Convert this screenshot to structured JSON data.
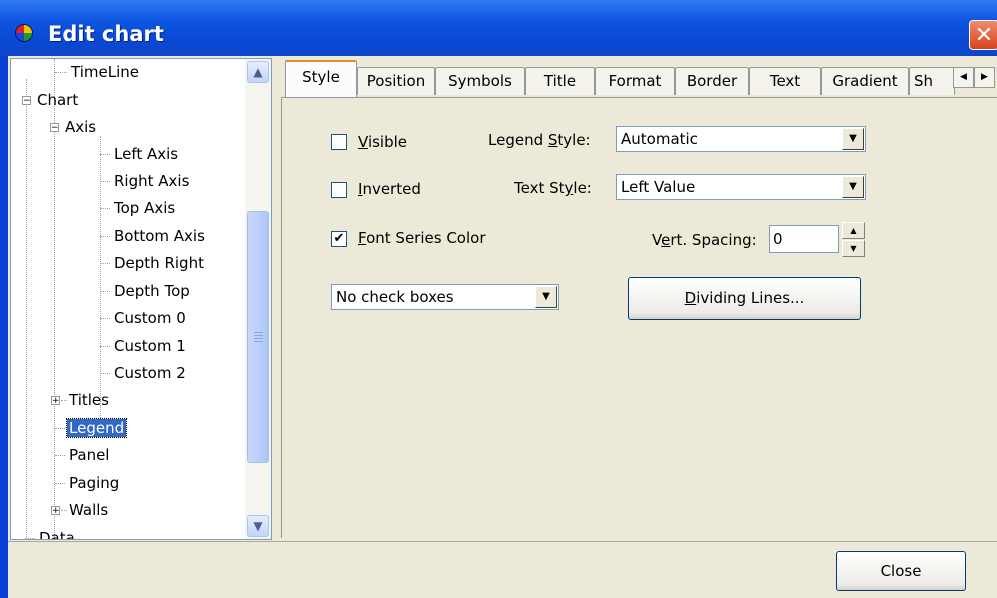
{
  "window": {
    "title": "Edit chart",
    "close_glyph": "✕"
  },
  "tree": {
    "items": [
      {
        "label": "TimeLine",
        "icon": "tree-leaf"
      },
      {
        "label": "Chart",
        "expander": "−"
      },
      {
        "label": "Axis",
        "expander": "−"
      },
      {
        "label": "Left Axis"
      },
      {
        "label": "Right Axis"
      },
      {
        "label": "Top Axis"
      },
      {
        "label": "Bottom Axis"
      },
      {
        "label": "Depth Right"
      },
      {
        "label": "Depth Top"
      },
      {
        "label": "Custom 0"
      },
      {
        "label": "Custom 1"
      },
      {
        "label": "Custom 2"
      },
      {
        "label": "Titles",
        "expander": "+"
      },
      {
        "label": "Legend",
        "selected": true
      },
      {
        "label": "Panel"
      },
      {
        "label": "Paging"
      },
      {
        "label": "Walls",
        "expander": "+"
      },
      {
        "label": "Data"
      }
    ],
    "scroll_up_glyph": "▲",
    "scroll_down_glyph": "▼"
  },
  "tabs": [
    {
      "label": "Style",
      "active": true
    },
    {
      "label": "Position"
    },
    {
      "label": "Symbols"
    },
    {
      "label": "Title"
    },
    {
      "label": "Format"
    },
    {
      "label": "Border"
    },
    {
      "label": "Text"
    },
    {
      "label": "Gradient"
    },
    {
      "label": "Sh"
    }
  ],
  "tab_scroll": {
    "left": "◀",
    "right": "▶"
  },
  "style_page": {
    "visible": {
      "label_pre": "",
      "label_u": "V",
      "label_post": "isible",
      "checked": false
    },
    "inverted": {
      "label_u": "I",
      "label_post": "nverted",
      "checked": false
    },
    "font_series_color": {
      "label_u": "F",
      "label_post": "ont Series Color",
      "checked": true,
      "check_glyph": "✔"
    },
    "legend_style": {
      "label_pre": "Legend ",
      "label_u": "S",
      "label_post": "tyle:",
      "value": "Automatic"
    },
    "text_style": {
      "label_pre": "Text St",
      "label_u": "y",
      "label_post": "le:",
      "value": "Left Value"
    },
    "vert_spacing": {
      "label_pre": "V",
      "label_u": "e",
      "label_post": "rt. Spacing:",
      "value": "0"
    },
    "check_boxes": {
      "value": "No check boxes"
    },
    "dividing_lines": {
      "label_u": "D",
      "label_post": "ividing Lines..."
    },
    "dropdown_glyph": "▼",
    "spin_up": "▲",
    "spin_down": "▼"
  },
  "footer": {
    "close_label": "Close"
  }
}
